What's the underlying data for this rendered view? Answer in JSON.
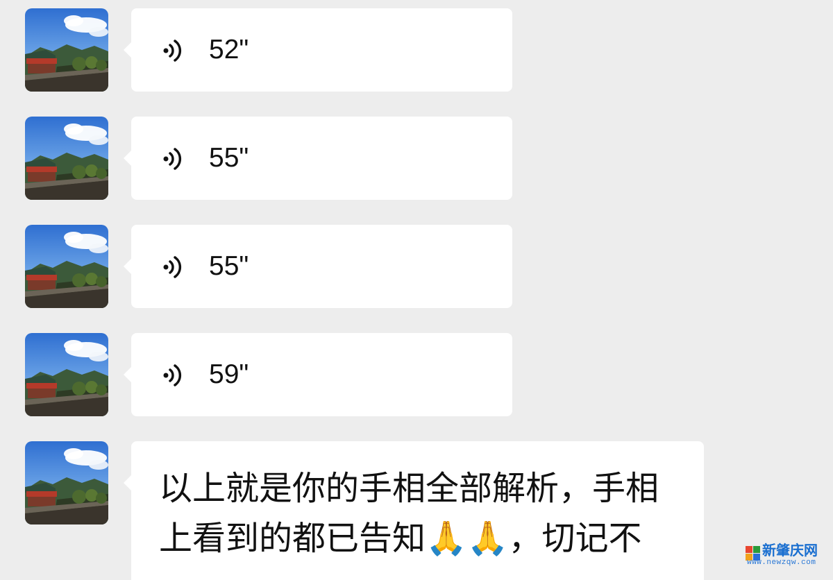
{
  "messages": [
    {
      "type": "voice",
      "duration": "52\""
    },
    {
      "type": "voice",
      "duration": "55\""
    },
    {
      "type": "voice",
      "duration": "55\""
    },
    {
      "type": "voice",
      "duration": "59\""
    },
    {
      "type": "text",
      "lines": [
        "以上就是你的手相全部解析，手相",
        "上看到的都已告知🙏🙏，切记不"
      ]
    }
  ],
  "icons": {
    "avatar": "landscape-avatar-icon",
    "voice": "voice-wave-icon",
    "emoji": "folded-hands-emoji"
  },
  "colors": {
    "background": "#ededed",
    "bubble": "#ffffff",
    "text": "#111111",
    "watermark": "#1a6fd0"
  },
  "watermark": {
    "name": "新肇庆网",
    "url": "www.newzqw.com"
  }
}
